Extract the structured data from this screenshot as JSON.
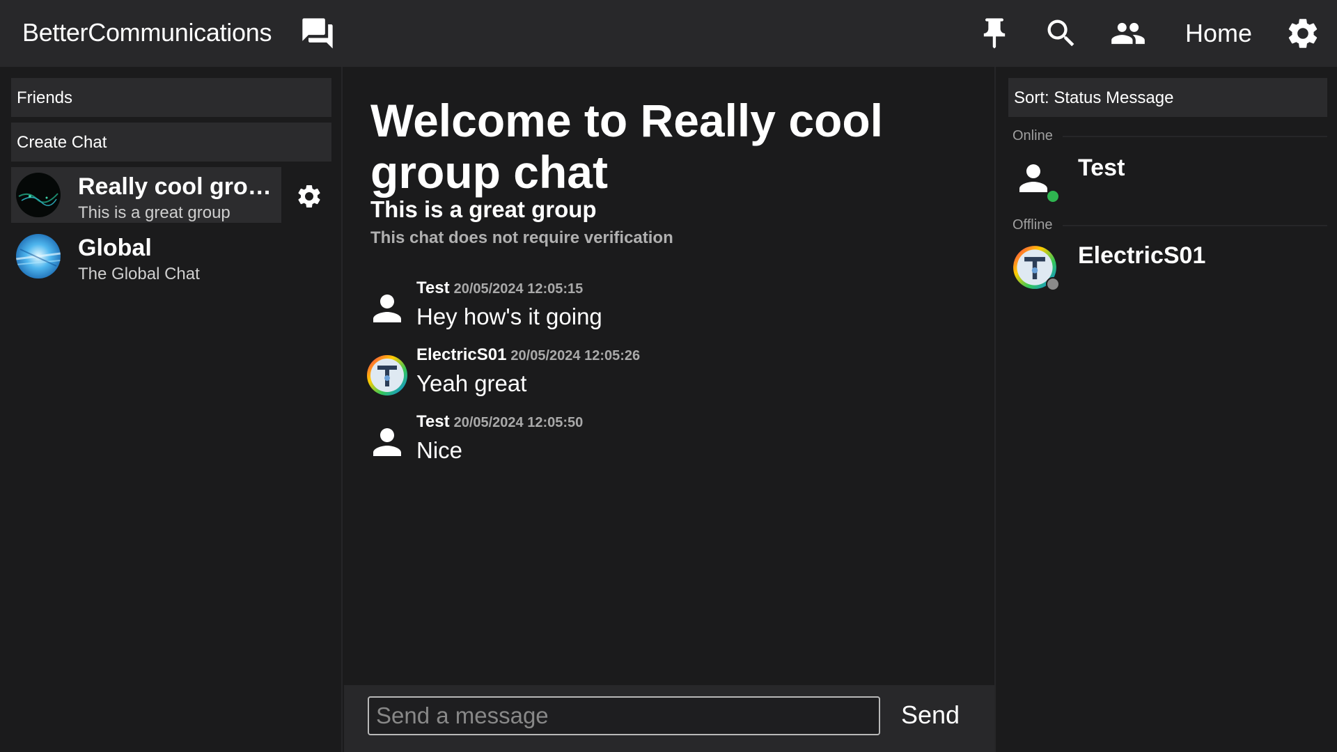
{
  "app": {
    "name": "BetterCommunications"
  },
  "topnav": {
    "home_label": "Home",
    "icons": [
      "chat-bubbles-icon",
      "pin-icon",
      "search-icon",
      "people-icon",
      "gear-icon"
    ]
  },
  "sidebar": {
    "friends_label": "Friends",
    "create_chat_label": "Create Chat",
    "chats": [
      {
        "name": "Really cool group chat",
        "description": "This is a great group",
        "active": true
      },
      {
        "name": "Global",
        "description": "The Global Chat",
        "active": false
      }
    ]
  },
  "main": {
    "welcome": "Welcome to Really cool group chat",
    "subtitle": "This is a great group",
    "verification": "This chat does not require verification",
    "messages": [
      {
        "author": "Test",
        "timestamp": "20/05/2024 12:05:15",
        "text": "Hey how's it going",
        "avatar": "default-user"
      },
      {
        "author": "ElectricS01",
        "timestamp": "20/05/2024 12:05:26",
        "text": "Yeah great",
        "avatar": "electric"
      },
      {
        "author": "Test",
        "timestamp": "20/05/2024 12:05:50",
        "text": "Nice",
        "avatar": "default-user"
      }
    ],
    "composer": {
      "placeholder": "Send a message",
      "send_label": "Send"
    }
  },
  "members": {
    "sort_label": "Sort: Status Message",
    "online_label": "Online",
    "offline_label": "Offline",
    "online": [
      {
        "name": "Test",
        "status": "online"
      }
    ],
    "offline": [
      {
        "name": "ElectricS01",
        "status": "offline"
      }
    ]
  },
  "colors": {
    "online": "#2fb550",
    "offline": "#8a8a8a",
    "background": "#1b1b1c",
    "bar": "#28282a"
  }
}
